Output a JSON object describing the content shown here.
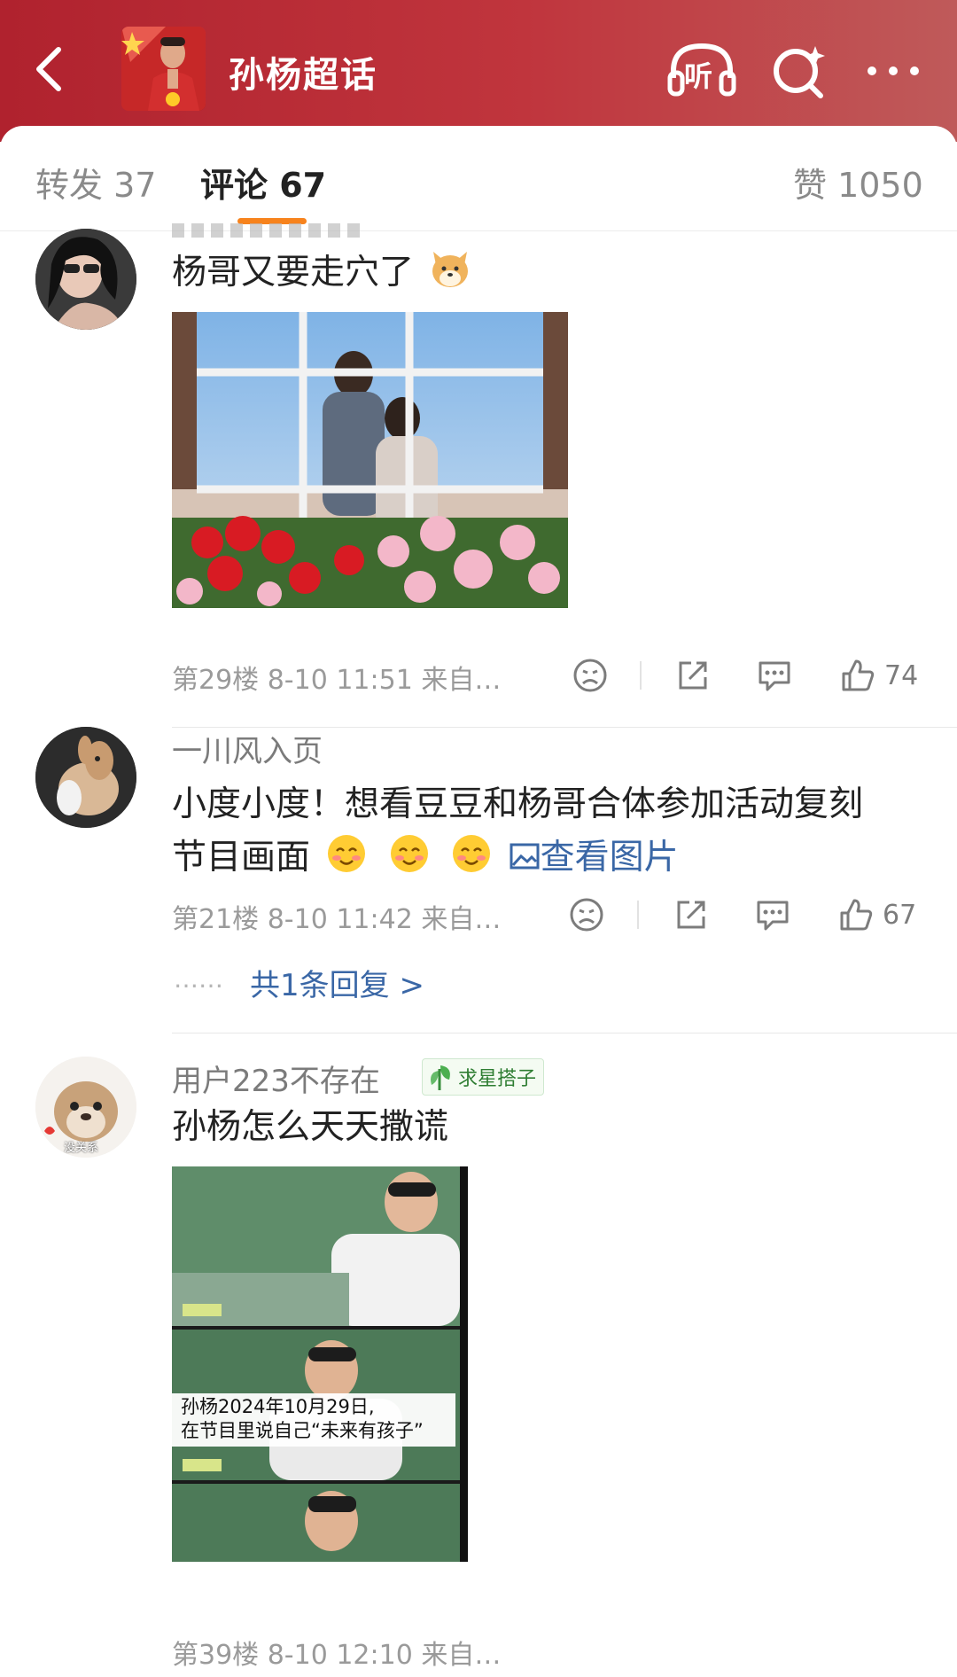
{
  "header": {
    "title": "孙杨超话",
    "back_icon": "chevron-left-icon",
    "listen_label": "听",
    "search_icon": "sparkle-search-icon",
    "more_icon": "more-dots-icon",
    "background": "#b0222e"
  },
  "tabs": [
    {
      "label": "转发 37",
      "active": false
    },
    {
      "label": "评论 67",
      "active": true
    },
    {
      "label": "赞 1050",
      "active": false
    }
  ],
  "accent_color": "#f7831d",
  "comments": [
    {
      "text": "杨哥又要走穴了",
      "emoji": "dog-emoji",
      "meta": "第29楼 8-10 11:51 来自…",
      "likes": "74"
    },
    {
      "username": "一川风入页",
      "text_line1": "小度小度！想看豆豆和杨哥合体参加活动复刻",
      "text_line2": "节目画面",
      "emoji": "blush-emoji",
      "view_image": "查看图片",
      "meta": "第21楼 8-10 11:42 来自…",
      "likes": "67",
      "replies": "共1条回复 >",
      "replies_dots": "……"
    },
    {
      "username": "用户223不存在",
      "badge": "求星搭子",
      "avatar_caption": "没关系",
      "text": "孙杨怎么天天撒谎",
      "image_caption_line1": "孙杨2024年10月29日,",
      "image_caption_line2": "在节目里说自己“未来有孩子”",
      "meta": "第39楼 8-10 12:10 来自…"
    }
  ]
}
